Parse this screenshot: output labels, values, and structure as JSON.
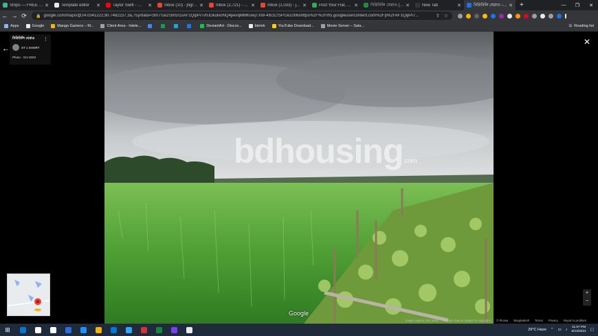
{
  "tabs": [
    {
      "title": "Stripo — FREE Em…",
      "color": "#41b883",
      "active": false
    },
    {
      "title": "Template editor",
      "color": "#e8eaed",
      "active": false
    },
    {
      "title": "Taylor Swift - …",
      "color": "#ff0000",
      "active": false
    },
    {
      "title": "Inbox (10) - jhgray…",
      "color": "#ea4335",
      "active": false
    },
    {
      "title": "Inbox (2,721) - abn…",
      "color": "#ea4335",
      "active": false
    },
    {
      "title": "Inbox (1,033) - jhal…",
      "color": "#ea4335",
      "active": false
    },
    {
      "title": "Post Your Flat, Lan…",
      "color": "#34a853",
      "active": false
    },
    {
      "title": "নিরিবিলি ঘেরাও (জ…",
      "color": "#1e8e3e",
      "active": false
    },
    {
      "title": "New Tab",
      "color": "#35363a",
      "active": false
    },
    {
      "title": "নিরিবিলি ঘেরাও - G…",
      "color": "#1a73e8",
      "active": true
    }
  ],
  "window_controls": {
    "minimize": "—",
    "maximize": "❐",
    "close": "✕"
  },
  "address": {
    "url": "google.com/maps/@24.0341222,90.7482237,3a,75y/data=!3m7!1e2!3m5!1sAF1QipPiTvfUOkulvoNQ4pevqMMKowjTXW-4!b1C!SP!2e1006shttps%2F%2Flh5.googleusercontent.com%2Fp%2FAF1QipPI7...",
    "lock": "🔒"
  },
  "bookmarks": [
    {
      "label": "Apps",
      "color": "#8ab4f8"
    },
    {
      "label": "Google",
      "color": "#e8eaed"
    },
    {
      "label": "Mango Gamers – M...",
      "color": "#f4b400"
    },
    {
      "label": "Client Area - Intele...",
      "color": "#9aa0a6"
    },
    {
      "label": "",
      "color": "#4285f4"
    },
    {
      "label": "",
      "color": "#0f9d58"
    },
    {
      "label": "",
      "color": "#1da1f2"
    },
    {
      "label": "",
      "color": "#1877f2"
    },
    {
      "label": "DeviantArt - Discov...",
      "color": "#05cc47"
    },
    {
      "label": "bkmrk",
      "color": "#e8eaed"
    },
    {
      "label": "YouTube Download...",
      "color": "#ffcc00"
    },
    {
      "label": "Movie Server – Sala...",
      "color": "#9aa0a6"
    }
  ],
  "reading_list": "Reading list",
  "photo_panel": {
    "title": "নিরিবিলি ঘেরাও",
    "author": "ST 1 SHORT",
    "date": "Photo - Oct 2020"
  },
  "watermark": {
    "text": "bdhousing",
    "suffix": ".com"
  },
  "google_logo": "Google",
  "footer": {
    "capture": "Image capture: Oct 2020",
    "copyright": "Images may be subject to copyright.",
    "privacy": "© Picasa",
    "country": "Bangladesh",
    "terms": "Terms",
    "privacy_link": "Privacy",
    "report": "Report a problem"
  },
  "zoom": {
    "plus": "+",
    "minus": "−"
  },
  "taskbar": {
    "apps": [
      "#0078d4",
      "#ffffff",
      "#ffffff",
      "#2b6ee0",
      "#1e90ff",
      "#f4b400",
      "#0078d4",
      "#31a8ff",
      "#d13438",
      "#10893e",
      "#7b3ff2",
      "#e8eaed"
    ],
    "weather": "29°C  Haze",
    "time": "11:07 PM",
    "date": "6/13/2021"
  }
}
